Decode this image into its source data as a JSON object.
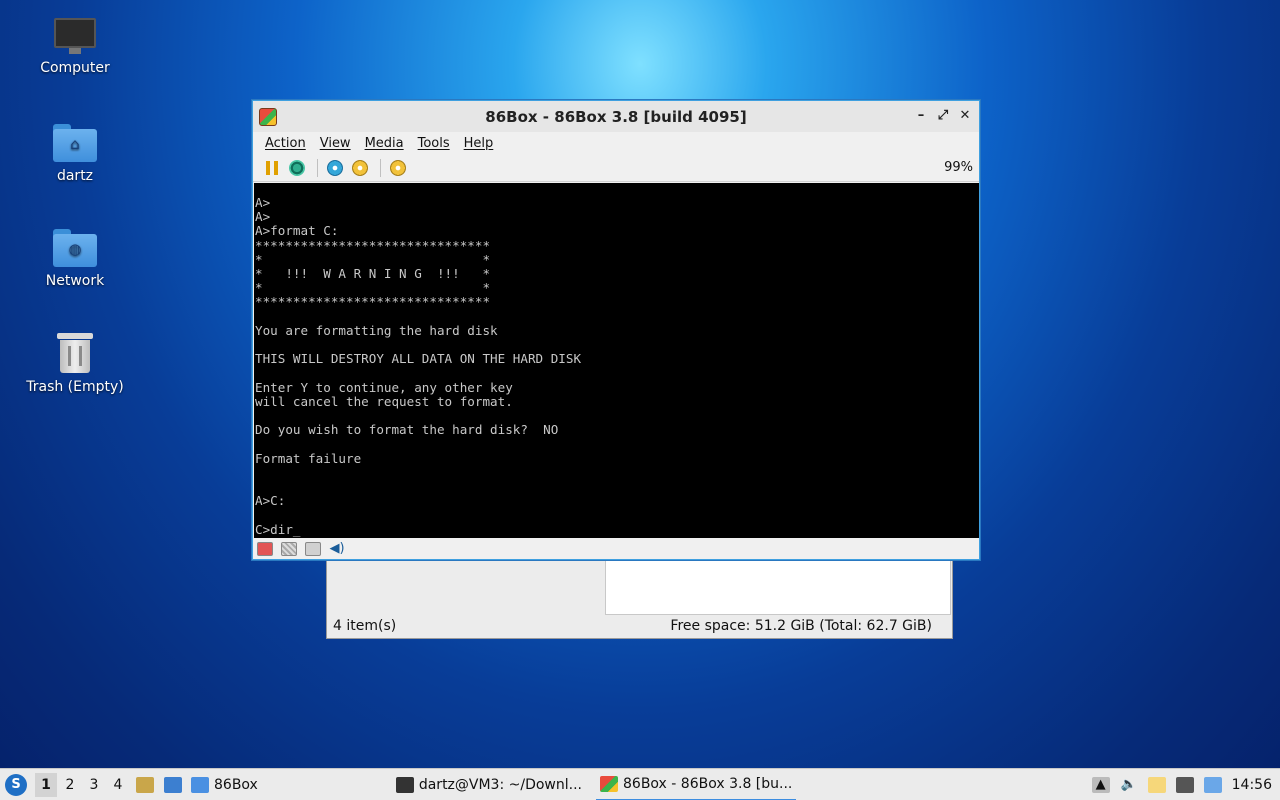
{
  "desktop": {
    "icons": [
      {
        "label": "Computer",
        "icon": "computer-icon"
      },
      {
        "label": "dartz",
        "icon": "home-folder-icon"
      },
      {
        "label": "Network",
        "icon": "network-folder-icon"
      },
      {
        "label": "Trash (Empty)",
        "icon": "trash-icon"
      }
    ]
  },
  "file_manager": {
    "items_count": "4 item(s)",
    "free_space": "Free space: 51.2 GiB (Total: 62.7 GiB)"
  },
  "emulator": {
    "title": "86Box - 86Box 3.8 [build 4095]",
    "menu": [
      "Action",
      "View",
      "Media",
      "Tools",
      "Help"
    ],
    "toolbar_icons": [
      "pause-icon",
      "ctrl-alt-del-icon",
      "cdrom-icon",
      "hard-reset-icon",
      "settings-icon"
    ],
    "zoom": "99%",
    "terminal_lines": [
      "A>",
      "A>",
      "A>format C:",
      "*******************************",
      "*                             *",
      "*   !!!  W A R N I N G  !!!   *",
      "*                             *",
      "*******************************",
      "",
      "You are formatting the hard disk",
      "",
      "THIS WILL DESTROY ALL DATA ON THE HARD DISK",
      "",
      "Enter Y to continue, any other key",
      "will cancel the request to format.",
      "",
      "Do you wish to format the hard disk?  NO",
      "",
      "Format failure",
      "",
      "",
      "A>C:",
      "",
      "C>dir_"
    ],
    "status_icons": [
      "floppy-icon",
      "disk-icon",
      "network-card-icon",
      "sound-icon"
    ]
  },
  "taskbar": {
    "workspaces": [
      "1",
      "2",
      "3",
      "4"
    ],
    "tasks": [
      {
        "label": "86Box",
        "icon": "folder-icon"
      },
      {
        "label": "dartz@VM3: ~/Downl...",
        "icon": "terminal-icon"
      },
      {
        "label": "86Box - 86Box 3.8 [bu...",
        "icon": "86box-icon"
      }
    ],
    "clock": "14:56",
    "colors": {
      "accent": "#3c8de0"
    }
  }
}
